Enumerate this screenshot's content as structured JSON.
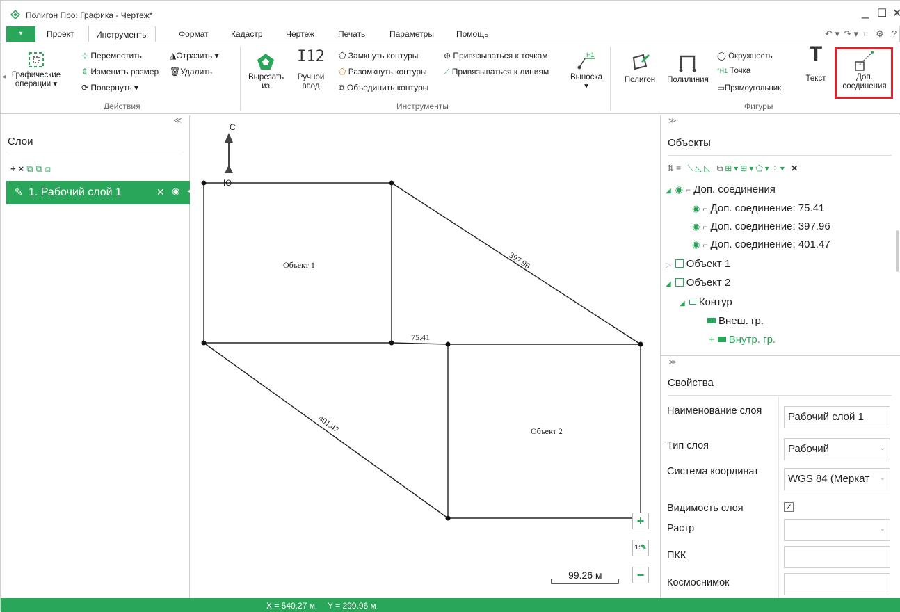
{
  "window": {
    "title": "Полигон Про: Графика - Чертеж*",
    "controls": {
      "minimize": "_",
      "maximize": "☐",
      "close": "✕"
    }
  },
  "menu": {
    "file_icon": "▾",
    "tabs": [
      "Проект",
      "Инструменты",
      "Формат",
      "Кадастр",
      "Чертеж",
      "Печать",
      "Параметры",
      "Помощь"
    ],
    "active_tab": "Инструменты"
  },
  "ribbon": {
    "groups": {
      "actions": "Действия",
      "tools": "Инструменты",
      "shapes": "Фигуры"
    },
    "actions": {
      "graphic_ops": "Графические операции",
      "move": "Переместить",
      "resize": "Изменить размер",
      "rotate": "Повернуть",
      "mirror": "Отразить",
      "delete": "Удалить"
    },
    "tools": {
      "cut_from": "Вырезать из",
      "manual_input": "Ручной ввод",
      "manual_icon_text": "I12",
      "close_contours": "Замкнуть контуры",
      "open_contours": "Разомкнуть контуры",
      "merge_contours": "Объединить контуры",
      "snap_points": "Привязываться к точкам",
      "snap_lines": "Привязываться к линиям",
      "callout": "Выноска"
    },
    "shapes": {
      "polygon": "Полигон",
      "polyline": "Полилиния",
      "circle": "Окружность",
      "point": "Точка",
      "rectangle": "Прямоугольник",
      "text": "Текст",
      "extra_connections": "Доп. соединения"
    }
  },
  "layers": {
    "title": "Слои",
    "items": [
      {
        "label": "1.  Рабочий слой 1"
      }
    ]
  },
  "canvas": {
    "north_label": "С",
    "south_label": "Ю",
    "object1_label": "Объект 1",
    "object2_label": "Объект 2",
    "dim_top_right": "397.96",
    "dim_middle": "75.41",
    "dim_bottom_left": "401.47",
    "scale_label": "99.26 м",
    "zoom_in": "+",
    "zoom_ratio": "1:",
    "zoom_out": "−"
  },
  "objects": {
    "title": "Объекты",
    "tree": [
      {
        "label": "Доп. соединения"
      },
      {
        "label": "Доп. соединение: 75.41"
      },
      {
        "label": "Доп. соединение: 397.96"
      },
      {
        "label": "Доп. соединение: 401.47"
      },
      {
        "label": "Объект 1"
      },
      {
        "label": "Объект 2"
      },
      {
        "label": "Контур"
      },
      {
        "label": "Внеш. гр."
      },
      {
        "label": "Внутр. гр."
      }
    ]
  },
  "properties": {
    "title": "Свойства",
    "rows": [
      {
        "label": "Наименование слоя",
        "value": "Рабочий слой 1"
      },
      {
        "label": "Тип слоя",
        "value": "Рабочий"
      },
      {
        "label": "Система координат",
        "value": "WGS 84 (Меркат"
      },
      {
        "label": "Видимость слоя",
        "value": "✓"
      },
      {
        "label": "Растр",
        "value": ""
      },
      {
        "label": "ПКК",
        "value": ""
      },
      {
        "label": "Космоснимок",
        "value": ""
      }
    ]
  },
  "status": {
    "x": "X = 540.27 м",
    "y": "Y = 299.96 м"
  },
  "colors": {
    "accent": "#2aa65a",
    "highlight": "#e0202a"
  }
}
